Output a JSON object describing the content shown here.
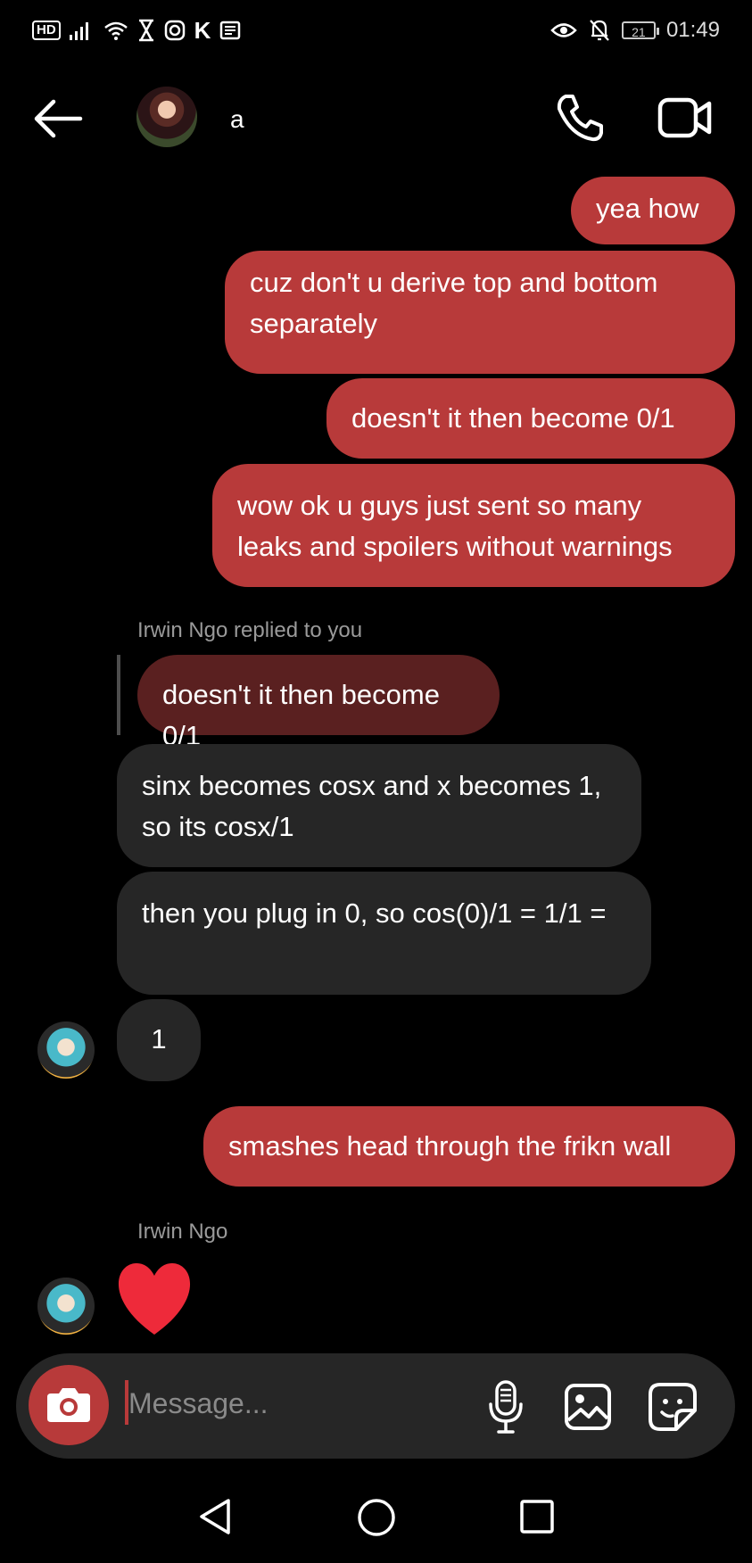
{
  "status_bar": {
    "hd_badge": "HD",
    "k_icon": "K",
    "battery": "21",
    "time": "01:49"
  },
  "header": {
    "contact_name": "a"
  },
  "messages": [
    {
      "from": "me",
      "text": "yea how"
    },
    {
      "from": "me",
      "text": "cuz don't u derive top and bottom separately"
    },
    {
      "from": "me",
      "text": "doesn't it then become 0/1"
    },
    {
      "from": "me",
      "text": "wow ok u guys just sent so many leaks and spoilers without warnings"
    },
    {
      "from": "them",
      "reply_note": "Irwin Ngo replied to you",
      "quoted_text": "doesn't it then become 0/1"
    },
    {
      "from": "them",
      "text": "sinx becomes cosx and x becomes 1, so its cosx/1"
    },
    {
      "from": "them",
      "text": "then you plug in 0, so cos(0)/1 = 1/1 ="
    },
    {
      "from": "them",
      "text": "1"
    },
    {
      "from": "me",
      "text": "smashes head through the frikn wall"
    },
    {
      "from": "them",
      "sender": "Irwin Ngo",
      "reaction": "heart"
    }
  ],
  "composer": {
    "placeholder": "Message..."
  },
  "colors": {
    "outgoing_bubble": "#b83a3a",
    "incoming_bubble": "#262626",
    "quoted_bubble": "#5a2020",
    "heart": "#ee2a3a"
  }
}
